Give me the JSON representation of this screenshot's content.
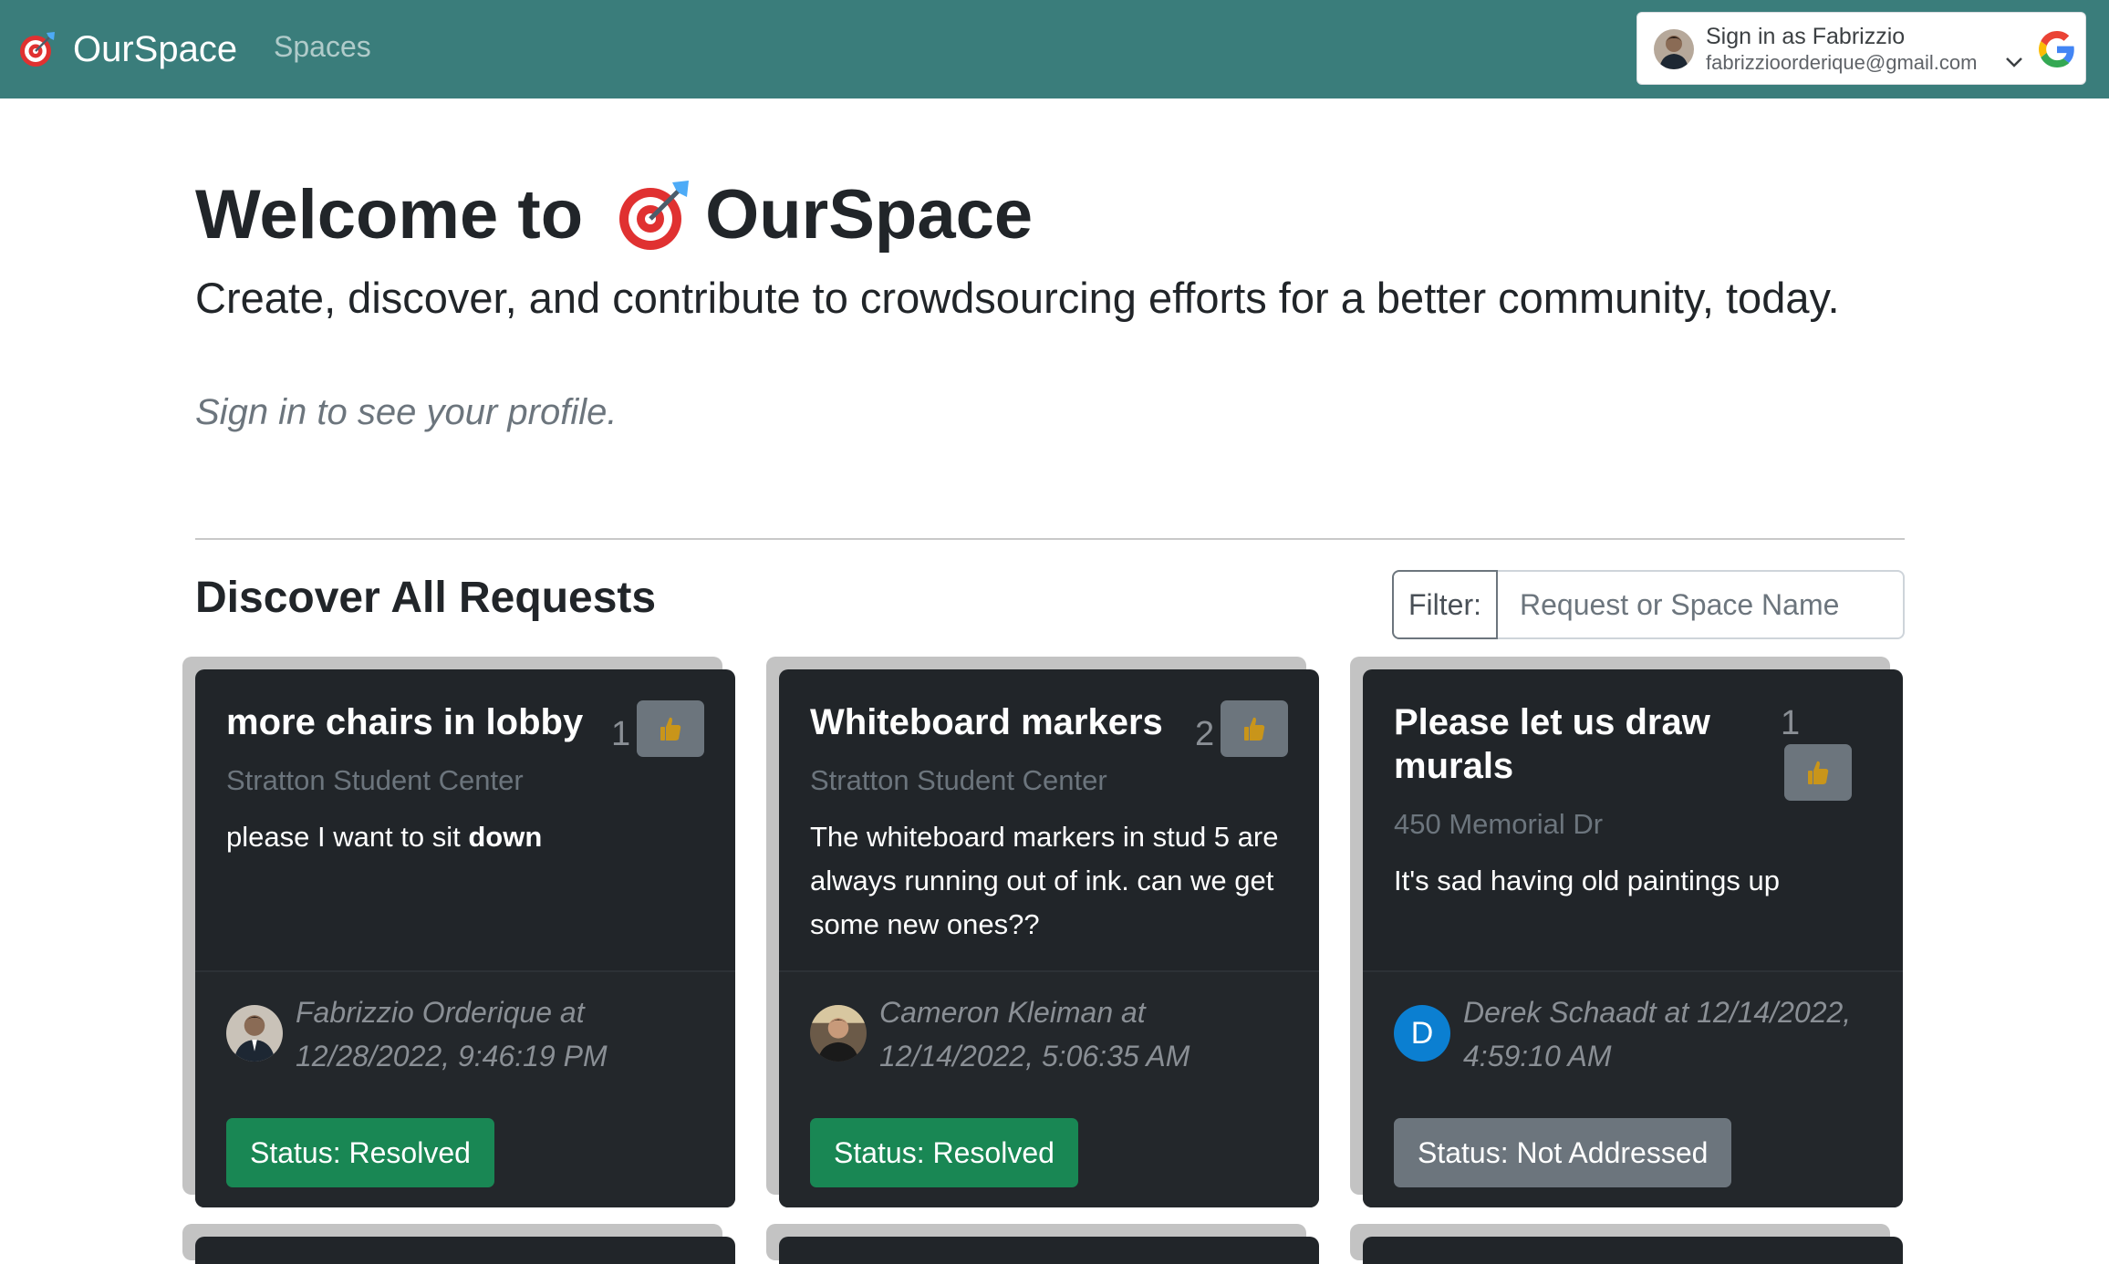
{
  "nav": {
    "brand": "OurSpace",
    "spaces_link": "Spaces",
    "google_signin": {
      "name_line": "Sign in as Fabrizzio",
      "email": "fabrizzioorderique@gmail.com"
    }
  },
  "hero": {
    "title_prefix": "Welcome to",
    "title_brand": "OurSpace",
    "subtitle": "Create, discover, and contribute to crowdsourcing efforts for a better community, today.",
    "note": "Sign in to see your profile."
  },
  "discover": {
    "title": "Discover All Requests",
    "filter_label": "Filter:",
    "filter_placeholder": "Request or Space Name"
  },
  "requests": [
    {
      "title": "more chairs in lobby",
      "votes": "1",
      "space": "Stratton Student Center",
      "body_prefix": "please I want to sit ",
      "body_bold": "down",
      "author": "Fabrizzio Orderique at 12/28/2022, 9:46:19 PM",
      "status": "Status: Resolved"
    },
    {
      "title": "Whiteboard markers",
      "votes": "2",
      "space": "Stratton Student Center",
      "body": "The whiteboard markers in stud 5 are always running out of ink. can we get some new ones??",
      "author": "Cameron Kleiman at 12/14/2022, 5:06:35 AM",
      "status": "Status: Resolved"
    },
    {
      "title": "Please let us draw murals",
      "votes": "1",
      "space": "450 Memorial Dr",
      "body": "It's sad having old paintings up",
      "author": "Derek Schaadt at 12/14/2022, 4:59:10 AM",
      "author_initial": "D",
      "status": "Status: Not Addressed"
    }
  ],
  "colors": {
    "navbar": "#3a7d7b",
    "card_bg": "#212529",
    "status_resolved": "#198754",
    "status_not_addressed": "#6c757d",
    "vote_button": "#6c757d",
    "thumb": "#c9951a"
  },
  "icons": {
    "brand": "dart-target-icon",
    "vote": "thumbs-up-icon",
    "google": "google-logo-icon",
    "chevron": "chevron-down-icon"
  }
}
